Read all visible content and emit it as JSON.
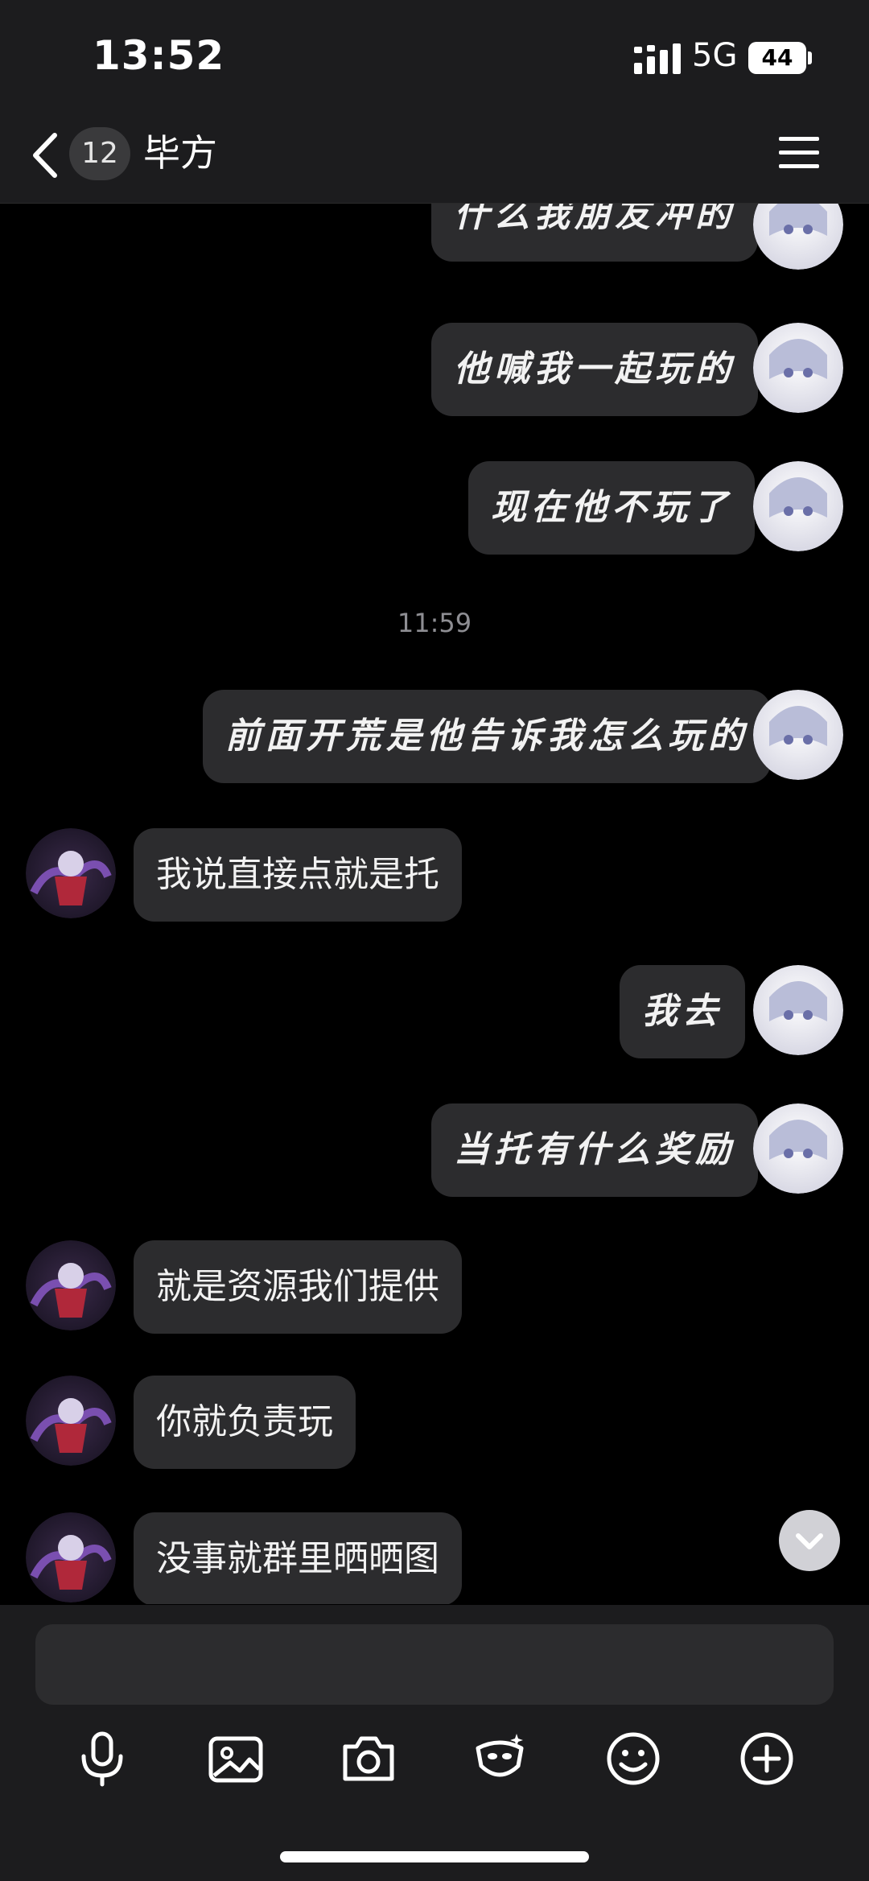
{
  "status_bar": {
    "time": "13:52",
    "network": "5G",
    "battery": "44"
  },
  "header": {
    "unread_count": "12",
    "title": "毕方"
  },
  "messages": [
    {
      "side": "out",
      "text": "什么我朋友冲的"
    },
    {
      "side": "out",
      "text": "他喊我一起玩的"
    },
    {
      "side": "out",
      "text": "现在他不玩了"
    },
    {
      "type": "timestamp",
      "text": "11:59"
    },
    {
      "side": "out",
      "text": "前面开荒是他告诉我怎么玩的"
    },
    {
      "side": "in",
      "text": "我说直接点就是托"
    },
    {
      "side": "out",
      "text": "我去"
    },
    {
      "side": "out",
      "text": "当托有什么奖励"
    },
    {
      "side": "in",
      "text": "就是资源我们提供"
    },
    {
      "side": "in",
      "text": "你就负责玩"
    },
    {
      "side": "in",
      "text": "没事就群里晒晒图"
    }
  ],
  "toolbar": {
    "icons": [
      "microphone-icon",
      "image-icon",
      "camera-icon",
      "sticker-icon",
      "emoji-icon",
      "plus-icon"
    ]
  }
}
